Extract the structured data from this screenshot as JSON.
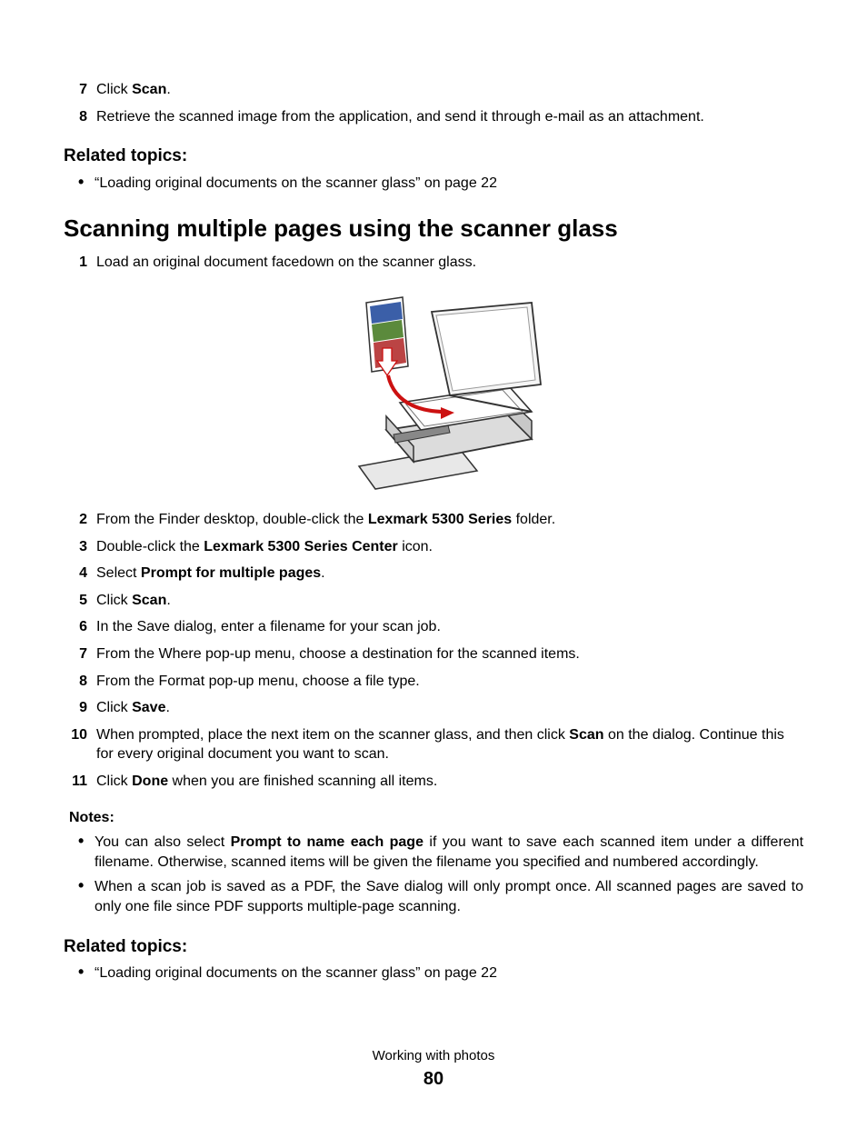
{
  "top_steps": [
    {
      "n": "7",
      "pre": "Click ",
      "b": "Scan",
      "post": "."
    },
    {
      "n": "8",
      "pre": "Retrieve the scanned image from the application, and send it through e-mail as an attachment.",
      "b": "",
      "post": ""
    }
  ],
  "related1": {
    "heading": "Related topics:",
    "items": [
      "“Loading original documents on the scanner glass” on page 22"
    ]
  },
  "section_title": "Scanning multiple pages using the scanner glass",
  "main_steps": [
    {
      "n": "1",
      "pre": "Load an original document facedown on the scanner glass.",
      "b": "",
      "post": ""
    },
    {
      "n": "2",
      "pre": "From the Finder desktop, double-click the ",
      "b": "Lexmark 5300 Series",
      "post": " folder."
    },
    {
      "n": "3",
      "pre": "Double-click the ",
      "b": "Lexmark 5300 Series Center",
      "post": " icon."
    },
    {
      "n": "4",
      "pre": "Select ",
      "b": "Prompt for multiple pages",
      "post": "."
    },
    {
      "n": "5",
      "pre": "Click ",
      "b": "Scan",
      "post": "."
    },
    {
      "n": "6",
      "pre": "In the Save dialog, enter a filename for your scan job.",
      "b": "",
      "post": ""
    },
    {
      "n": "7",
      "pre": "From the Where pop-up menu, choose a destination for the scanned items.",
      "b": "",
      "post": ""
    },
    {
      "n": "8",
      "pre": "From the Format pop-up menu, choose a file type.",
      "b": "",
      "post": ""
    },
    {
      "n": "9",
      "pre": "Click ",
      "b": "Save",
      "post": "."
    },
    {
      "n": "10",
      "pre": "When prompted, place the next item on the scanner glass, and then click ",
      "b": "Scan",
      "post": " on the dialog. Continue this for every original document you want to scan."
    },
    {
      "n": "11",
      "pre": "Click ",
      "b": "Done",
      "post": " when you are finished scanning all items."
    }
  ],
  "notes": {
    "heading": "Notes:",
    "items": [
      {
        "pre": "You can also select ",
        "b": "Prompt to name each page",
        "post": " if you want to save each scanned item under a different filename. Otherwise, scanned items will be given the filename you specified and numbered accordingly."
      },
      {
        "pre": "When a scan job is saved as a PDF, the Save dialog will only prompt once. All scanned pages are saved to only one file since PDF supports multiple-page scanning.",
        "b": "",
        "post": ""
      }
    ]
  },
  "related2": {
    "heading": "Related topics:",
    "items": [
      "“Loading original documents on the scanner glass” on page 22"
    ]
  },
  "footer": {
    "label": "Working with photos",
    "page": "80"
  },
  "figure": {
    "name": "scanner-load-document-illustration"
  }
}
